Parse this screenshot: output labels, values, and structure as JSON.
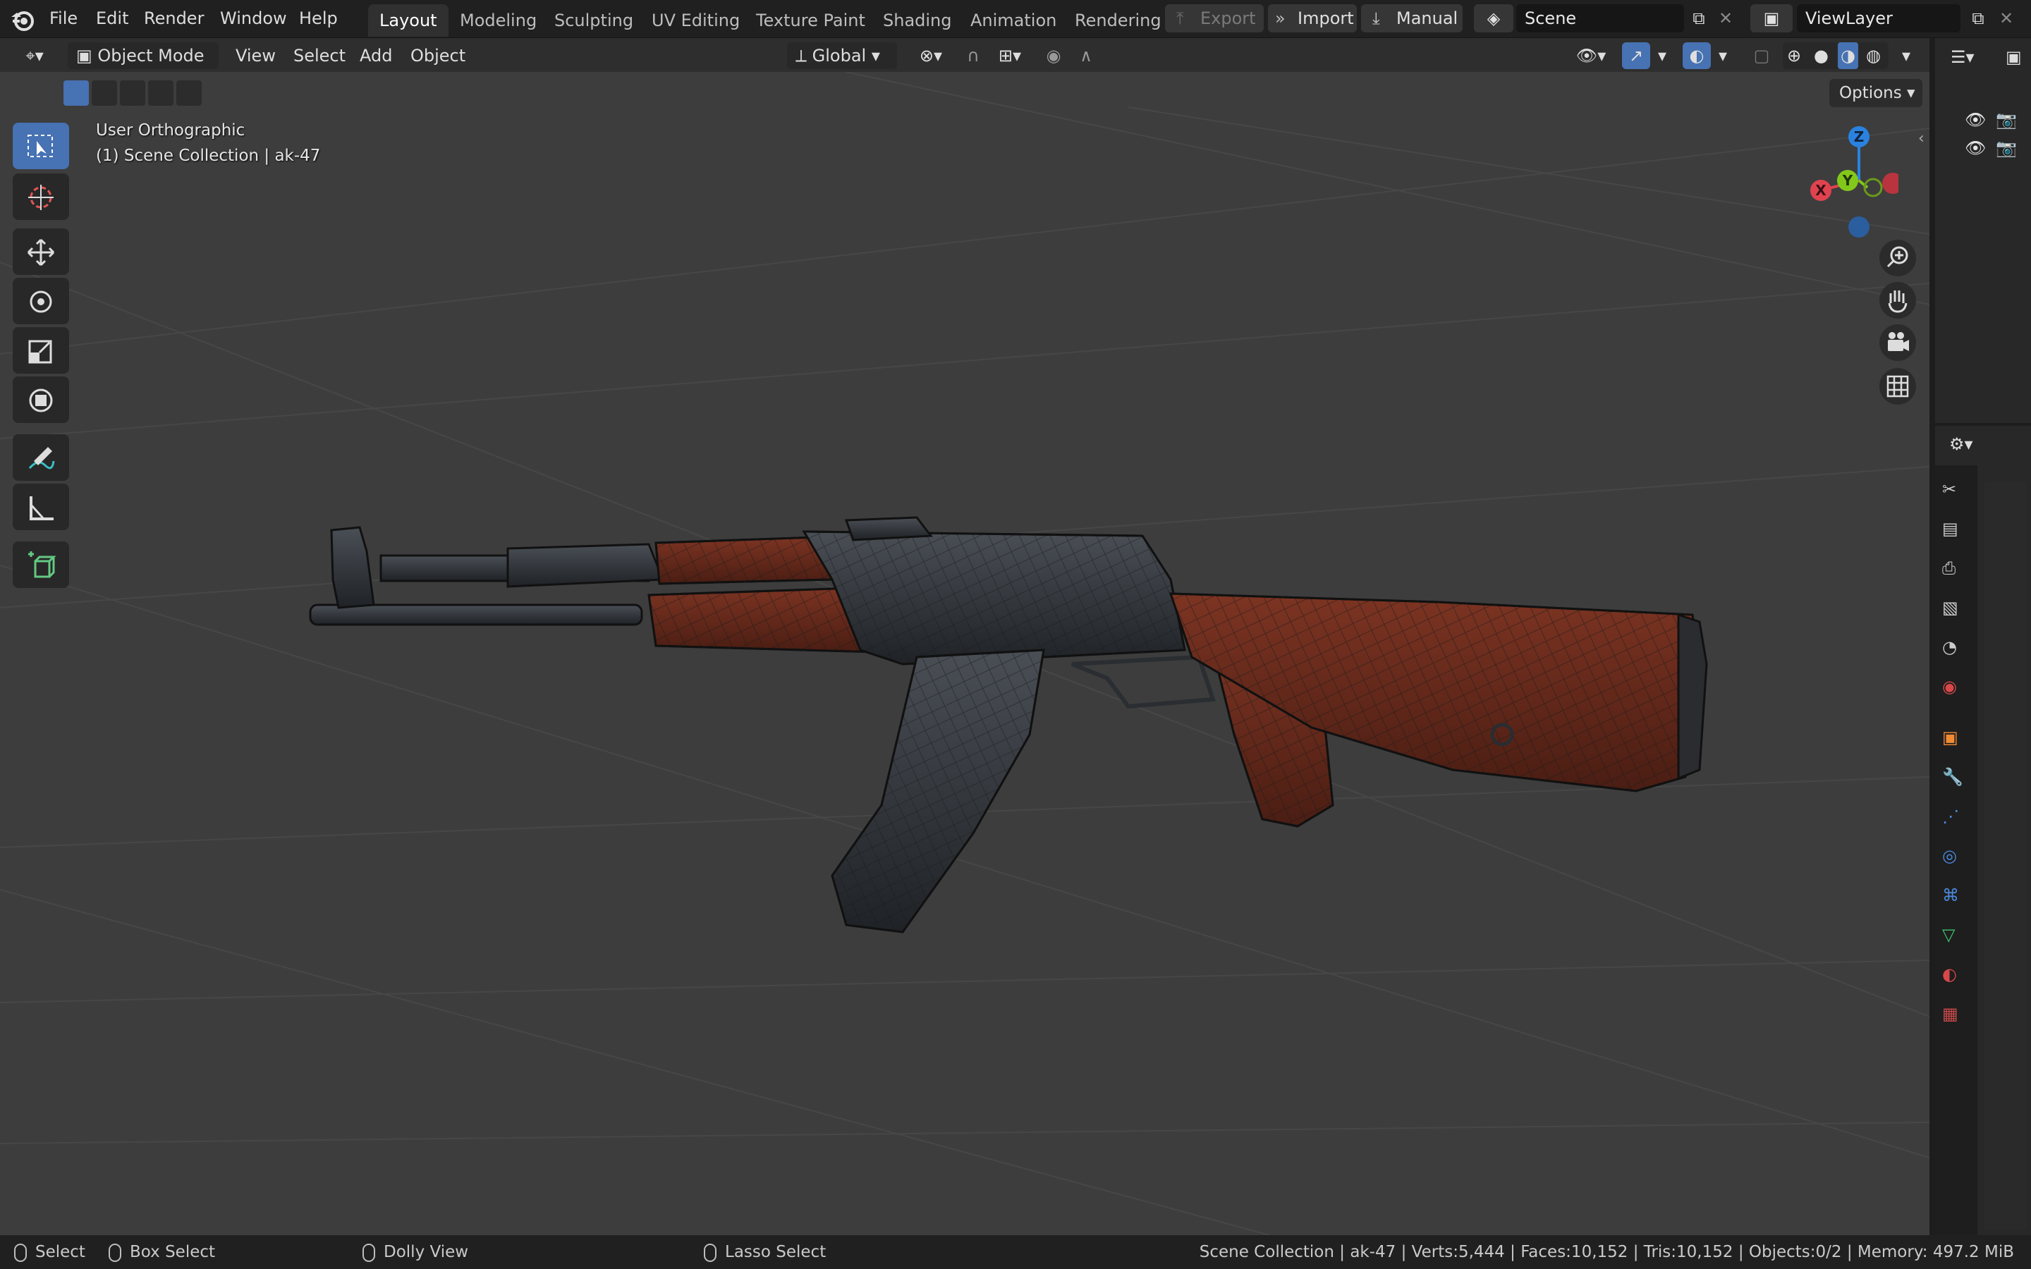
{
  "menus": [
    "File",
    "Edit",
    "Render",
    "Window",
    "Help"
  ],
  "workspaces": [
    "Layout",
    "Modeling",
    "Sculpting",
    "UV Editing",
    "Texture Paint",
    "Shading",
    "Animation",
    "Rendering"
  ],
  "active_workspace": "Layout",
  "top_actions": {
    "export": "Export",
    "import": "Import",
    "manual": "Manual"
  },
  "scene_name": "Scene",
  "view_layer": "ViewLayer",
  "viewport_header": {
    "mode": "Object Mode",
    "menus": [
      "View",
      "Select",
      "Add",
      "Object"
    ],
    "transform_orientation": "Global"
  },
  "viewport": {
    "view_name": "User Orthographic",
    "collection_info": "(1) Scene Collection | ak-47",
    "options_label": "Options",
    "gizmo_axes": {
      "z": "Z",
      "y": "Y",
      "x": "X"
    },
    "axis_colors": {
      "x": "#e0434f",
      "y": "#82c81a",
      "z": "#2a82e0"
    }
  },
  "status": {
    "select": "Select",
    "box_select": "Box Select",
    "dolly_view": "Dolly View",
    "lasso_select": "Lasso Select",
    "stats": "Scene Collection | ak-47 | Verts:5,444 | Faces:10,152 | Tris:10,152 | Objects:0/2 | Memory: 497.2 MiB"
  },
  "colors": {
    "accent": "#4772b3",
    "viewport_bg": "#3d3d3d",
    "wood": "#6b2a1c",
    "metal": "#2c2f33"
  }
}
